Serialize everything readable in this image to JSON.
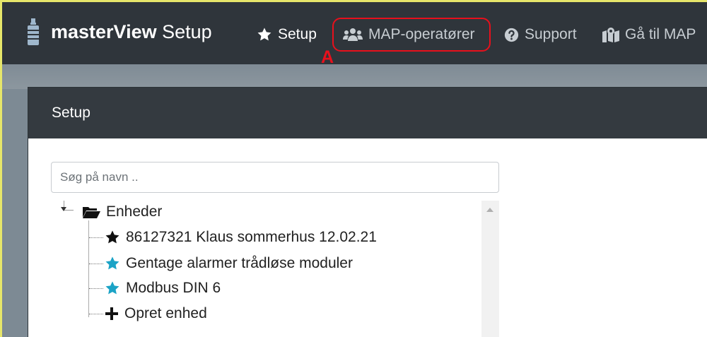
{
  "navbar": {
    "brand_bold": "masterView",
    "brand_rest": " Setup",
    "items": [
      {
        "label": "Setup",
        "icon": "star-icon",
        "active": true
      },
      {
        "label": "MAP-operatører",
        "icon": "users-icon",
        "active": false
      },
      {
        "label": "Support",
        "icon": "question-circle-icon",
        "active": false
      },
      {
        "label": "Gå til MAP",
        "icon": "map-icon",
        "active": false
      }
    ]
  },
  "annotation": {
    "letter": "A",
    "color": "#e8101c"
  },
  "card": {
    "title": "Setup"
  },
  "search": {
    "placeholder": "Søg på navn .."
  },
  "tree": {
    "root": {
      "label": "Enheder",
      "icon": "folder-open-icon"
    },
    "children": [
      {
        "label": "86127321 Klaus sommerhus 12.02.21",
        "icon": "star-icon",
        "color": "#111111"
      },
      {
        "label": "Gentage alarmer trådløse moduler",
        "icon": "star-icon",
        "color": "#1ba3c6"
      },
      {
        "label": "Modbus DIN 6",
        "icon": "star-icon",
        "color": "#1ba3c6"
      },
      {
        "label": "Opret enhed",
        "icon": "plus-icon",
        "color": "#111111"
      }
    ]
  },
  "colors": {
    "navbar": "#2f353b",
    "card_header": "#343a40",
    "accent_teal": "#1ba3c6",
    "highlight": "#e8101c"
  }
}
